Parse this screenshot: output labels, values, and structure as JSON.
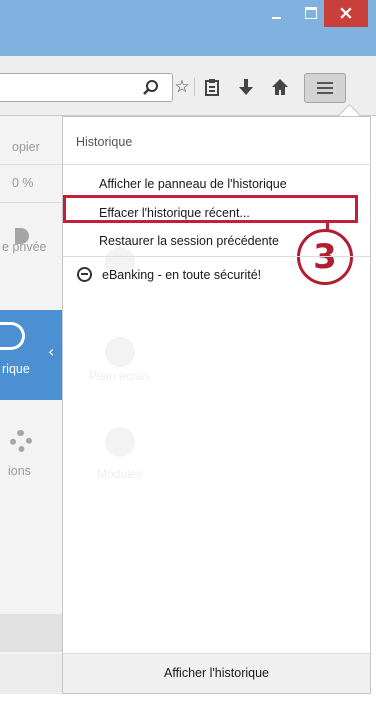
{
  "window": {
    "controls": {
      "minimize": "minimize-icon",
      "maximize": "maximize-icon",
      "close": "close-icon"
    }
  },
  "toolbar": {
    "icons": [
      "search-icon",
      "star-icon",
      "clipboard-icon",
      "download-icon",
      "home-icon",
      "hamburger-menu-icon"
    ]
  },
  "left_menu": {
    "items": [
      "opier",
      "0 %",
      "e privée",
      "rique",
      "ions"
    ],
    "selected_color": "#4a90d2"
  },
  "popup": {
    "title": "Historique",
    "items": [
      "Afficher le panneau de l'historique",
      "Effacer l'historique récent...",
      "Restaurer la session précédente"
    ],
    "bookmark": "eBanking - en toute sécurité!",
    "footer_button": "Afficher l'historique",
    "ghost_labels": [
      "Plein écran",
      "Modules"
    ]
  },
  "annotation": {
    "step_number": "3",
    "color": "#c0203a"
  }
}
